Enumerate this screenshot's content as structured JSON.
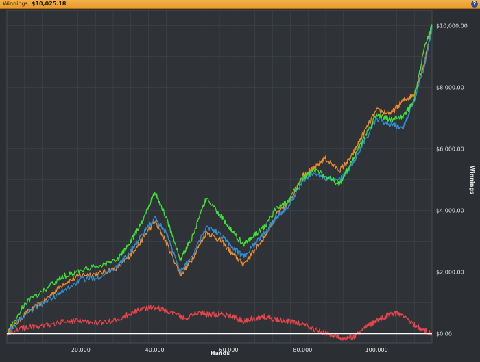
{
  "window": {
    "summary_label": "Winnings:",
    "summary_value": "$10,025.18",
    "help_icon": "question-circle-icon"
  },
  "chart_data": {
    "type": "line",
    "xlabel": "Hands",
    "ylabel": "Winnings",
    "xlim": [
      0,
      115000
    ],
    "ylim": [
      -300,
      10500
    ],
    "x_ticks": [
      20000,
      40000,
      60000,
      80000,
      100000
    ],
    "x_tick_labels": [
      "20,000",
      "40,000",
      "60,000",
      "80,000",
      "100,000"
    ],
    "y_ticks": [
      0,
      2000,
      4000,
      6000,
      8000,
      10000
    ],
    "y_tick_labels": [
      "$0.00",
      "$2,000.00",
      "$4,000.00",
      "$6,000.00",
      "$8,000.00",
      "$10,000.00"
    ],
    "grid": true,
    "background": "#2f3337",
    "grid_color": "#454a50",
    "series": [
      {
        "color": "#f08a2c",
        "x": [
          0,
          5000,
          10000,
          15000,
          20000,
          25000,
          30000,
          33000,
          36000,
          40000,
          43000,
          47000,
          50000,
          54000,
          58000,
          61000,
          64000,
          67000,
          70000,
          73000,
          76000,
          80000,
          83000,
          86000,
          90000,
          93000,
          96000,
          100000,
          104000,
          107000,
          110000,
          113000,
          115000
        ],
        "values": [
          0,
          650,
          1050,
          1600,
          1900,
          1950,
          2150,
          2500,
          2950,
          3650,
          3000,
          1900,
          2400,
          3300,
          3000,
          2600,
          2250,
          2700,
          3200,
          3900,
          4200,
          5150,
          5350,
          5700,
          5300,
          5700,
          6400,
          7250,
          7150,
          7550,
          7750,
          8800,
          10025
        ]
      },
      {
        "color": "#2f8fd6",
        "x": [
          0,
          5000,
          10000,
          15000,
          20000,
          25000,
          30000,
          33000,
          36000,
          40000,
          43000,
          47000,
          50000,
          54000,
          58000,
          61000,
          64000,
          67000,
          70000,
          73000,
          76000,
          80000,
          83000,
          86000,
          90000,
          93000,
          96000,
          100000,
          104000,
          107000,
          110000,
          113000,
          115000
        ],
        "values": [
          0,
          650,
          1000,
          1350,
          1750,
          1850,
          2200,
          2600,
          3100,
          3750,
          3300,
          2000,
          2500,
          3500,
          3200,
          2800,
          2500,
          2900,
          3300,
          3800,
          4100,
          4950,
          5200,
          5050,
          5000,
          5400,
          6100,
          6950,
          6800,
          6650,
          7500,
          8700,
          9950
        ]
      },
      {
        "color": "#3ee03a",
        "x": [
          0,
          5000,
          10000,
          15000,
          20000,
          25000,
          30000,
          33000,
          36000,
          40000,
          43000,
          47000,
          50000,
          54000,
          58000,
          61000,
          64000,
          67000,
          70000,
          73000,
          76000,
          80000,
          83000,
          86000,
          90000,
          93000,
          96000,
          100000,
          104000,
          107000,
          110000,
          113000,
          115000
        ],
        "values": [
          0,
          1000,
          1400,
          1850,
          2050,
          2200,
          2400,
          2900,
          3500,
          4600,
          3800,
          2400,
          3100,
          4400,
          3800,
          3300,
          2900,
          3200,
          3500,
          4100,
          4300,
          5050,
          5300,
          5150,
          4850,
          5500,
          6200,
          7100,
          6950,
          7050,
          7500,
          9300,
          10025
        ]
      },
      {
        "color": "#e8444a",
        "x": [
          0,
          5000,
          10000,
          15000,
          20000,
          25000,
          30000,
          34000,
          37000,
          40000,
          44000,
          48000,
          52000,
          55000,
          58000,
          61000,
          64000,
          67000,
          70000,
          73000,
          76000,
          80000,
          84000,
          88000,
          91000,
          94000,
          97000,
          100000,
          103000,
          106000,
          109000,
          112000,
          115000
        ],
        "values": [
          0,
          200,
          250,
          380,
          430,
          350,
          450,
          700,
          800,
          850,
          700,
          500,
          700,
          600,
          650,
          550,
          400,
          500,
          550,
          450,
          400,
          300,
          100,
          -50,
          -150,
          -100,
          200,
          400,
          600,
          650,
          400,
          150,
          0
        ]
      },
      {
        "color": "#ffffff",
        "x": [
          0,
          115000
        ],
        "values": [
          0,
          0
        ]
      }
    ]
  }
}
